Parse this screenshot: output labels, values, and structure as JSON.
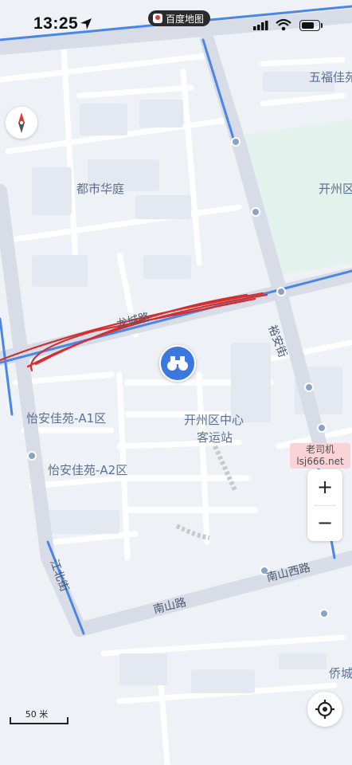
{
  "status_bar": {
    "time": "13:25",
    "app_name": "百度地图"
  },
  "places": {
    "dushi_huating": "都市华庭",
    "wufu_jiayuan": "五福佳苑",
    "kaizhou": "开州区",
    "yian_a1": "怡安佳苑-A1区",
    "yian_a2": "怡安佳苑-A2区",
    "bus_station_line1": "开州区中心",
    "bus_station_line2": "客运站",
    "qiaocheng": "侨城"
  },
  "roads": {
    "longcheng": "龙城路",
    "yuan": "裕安街",
    "jiangbei": "江北街",
    "nanshan": "南山路",
    "nanshan_west": "南山西路"
  },
  "watermark": {
    "line1": "老司机",
    "line2": "lsj666.net"
  },
  "zoom": {
    "in": "+",
    "out": "−"
  },
  "scale_label": "50 米",
  "colors": {
    "route": "#d32f2f",
    "road_blue": "#4a86e8",
    "poi": "#3a78e0"
  }
}
